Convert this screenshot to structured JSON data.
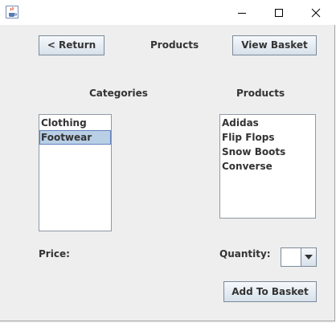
{
  "window": {
    "icon": "java-cup-icon",
    "controls": {
      "minimize": "minimize-icon",
      "maximize": "maximize-icon",
      "close": "close-icon"
    }
  },
  "header": {
    "return_label": "< Return",
    "title": "Products",
    "basket_label": "View Basket"
  },
  "categories": {
    "heading": "Categories",
    "items": [
      "Clothing",
      "Footwear"
    ],
    "selected": "Footwear"
  },
  "products": {
    "heading": "Products",
    "items": [
      "Adidas",
      "Flip Flops",
      "Snow Boots",
      "Converse"
    ]
  },
  "price": {
    "label": "Price:",
    "value": ""
  },
  "quantity": {
    "label": "Quantity:",
    "value": ""
  },
  "add_label": "Add To Basket",
  "colors": {
    "window_bg": "#eeeeee",
    "selection_bg": "#b8cfe5",
    "selection_border": "#6382bf",
    "button_border": "#7a8a99"
  }
}
